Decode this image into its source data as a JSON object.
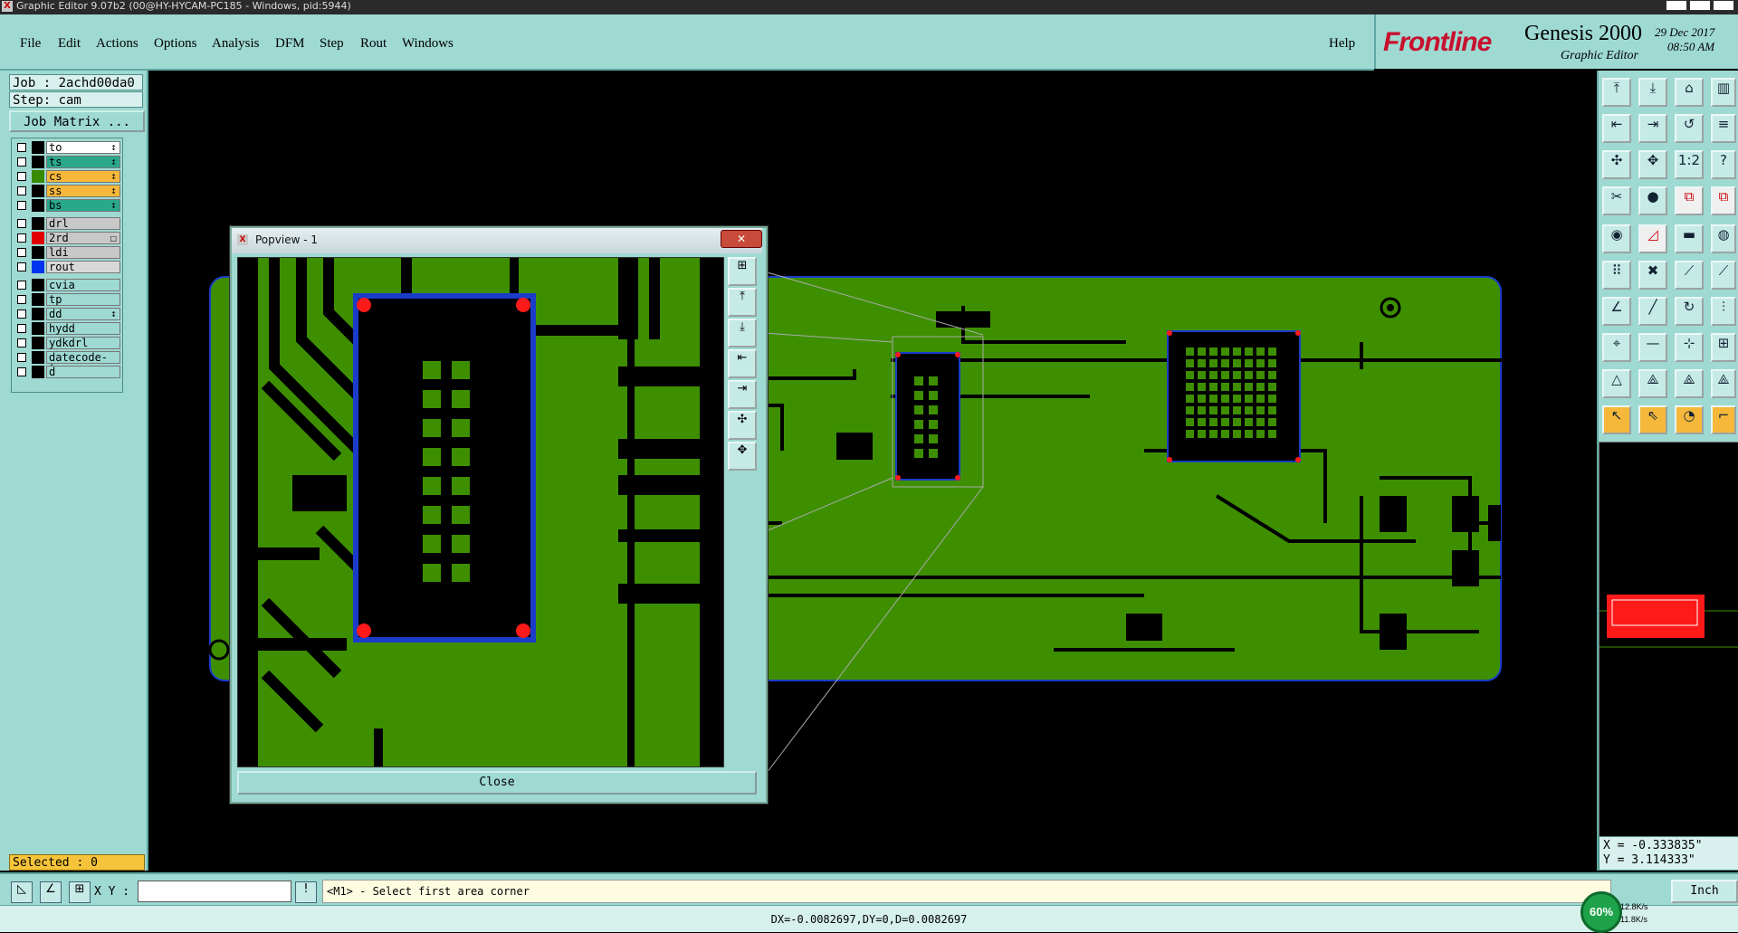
{
  "window": {
    "title": "Graphic Editor 9.07b2 (00@HY-HYCAM-PC185 - Windows, pid:5944)"
  },
  "menu": {
    "items": [
      "File",
      "Edit",
      "Actions",
      "Options",
      "Analysis",
      "DFM",
      "Step",
      "Rout",
      "Windows"
    ],
    "help": "Help"
  },
  "brand": {
    "logo": "Frontline",
    "product": "Genesis 2000",
    "subtitle": "Graphic Editor",
    "date": "29 Dec 2017",
    "time": "08:50 AM"
  },
  "job": {
    "job_label": "Job : 2achd00da0",
    "step_label": "Step: cam",
    "matrix_button": "Job Matrix ..."
  },
  "layers": [
    {
      "name": "to",
      "color": "#000000",
      "bg": "#ffffff",
      "flag": "↕"
    },
    {
      "name": "ts",
      "color": "#000000",
      "bg": "#2aa88a",
      "flag": "↕"
    },
    {
      "name": "cs",
      "color": "#3a8a00",
      "bg": "#f5b83a",
      "flag": "↕"
    },
    {
      "name": "ss",
      "color": "#000000",
      "bg": "#f5b83a",
      "flag": "↕"
    },
    {
      "name": "bs",
      "color": "#000000",
      "bg": "#2aa88a",
      "flag": "↕"
    },
    {
      "name": "drl",
      "color": "#000000",
      "bg": "#c8c8c8",
      "flag": ""
    },
    {
      "name": "2rd",
      "color": "#e00000",
      "bg": "#c8c8c8",
      "flag": "□"
    },
    {
      "name": "ldi",
      "color": "#000000",
      "bg": "#c8c8c8",
      "flag": ""
    },
    {
      "name": "rout",
      "color": "#0033ee",
      "bg": "#d8d8d8",
      "flag": ""
    },
    {
      "name": "cvia",
      "color": "#000000",
      "bg": "#9ed9d2",
      "flag": ""
    },
    {
      "name": "tp",
      "color": "#000000",
      "bg": "#9ed9d2",
      "flag": ""
    },
    {
      "name": "dd",
      "color": "#000000",
      "bg": "#9ed9d2",
      "flag": "↕"
    },
    {
      "name": "hydd",
      "color": "#000000",
      "bg": "#9ed9d2",
      "flag": ""
    },
    {
      "name": "ydkdrl",
      "color": "#000000",
      "bg": "#9ed9d2",
      "flag": ""
    },
    {
      "name": "datecode-to",
      "color": "#000000",
      "bg": "#9ed9d2",
      "flag": ""
    },
    {
      "name": "d",
      "color": "#000000",
      "bg": "#9ed9d2",
      "flag": ""
    }
  ],
  "selected": "Selected : 0",
  "popview": {
    "title": "Popview - 1",
    "close_label": "Close"
  },
  "coords": {
    "x": "X = -0.333835\"",
    "y": "Y = 3.114333\""
  },
  "command": {
    "xy_label": "X Y :",
    "xy_value": "",
    "prompt": "<M1> - Select first area corner",
    "unit": "Inch"
  },
  "status": {
    "measure": "DX=-0.0082697,DY=0,D=0.0082697",
    "cpu": "60%",
    "net_up": "12.8K/s",
    "net_down": "11.8K/s"
  },
  "colors": {
    "board": "#3e8f00",
    "panel": "#9ed9d2",
    "outline": "#1a3cc8",
    "pad": "#ff1a1a"
  }
}
